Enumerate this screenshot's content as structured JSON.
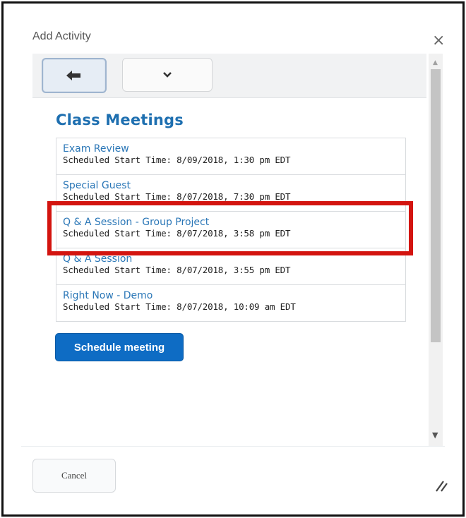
{
  "dialog": {
    "title": "Add Activity",
    "close_label": "×"
  },
  "toolbar": {
    "back_icon": "back-arrow-icon",
    "more_icon": "chevron-down-icon"
  },
  "section": {
    "title": "Class Meetings"
  },
  "meetings": [
    {
      "name": "Exam Review",
      "time": "Scheduled Start Time: 8/09/2018, 1:30 pm EDT"
    },
    {
      "name": "Special Guest",
      "time": "Scheduled Start Time: 8/07/2018, 7:30 pm EDT"
    },
    {
      "name": "Q & A Session - Group Project",
      "time": "Scheduled Start Time: 8/07/2018, 3:58 pm EDT"
    },
    {
      "name": "Q & A Session",
      "time": "Scheduled Start Time: 8/07/2018, 3:55 pm EDT"
    },
    {
      "name": "Right Now - Demo",
      "time": "Scheduled Start Time: 8/07/2018, 10:09 am EDT"
    }
  ],
  "buttons": {
    "schedule": "Schedule meeting",
    "cancel": "Cancel"
  },
  "colors": {
    "accent": "#0e6cc4",
    "link": "#2b77b7",
    "highlight": "#d3140f"
  }
}
